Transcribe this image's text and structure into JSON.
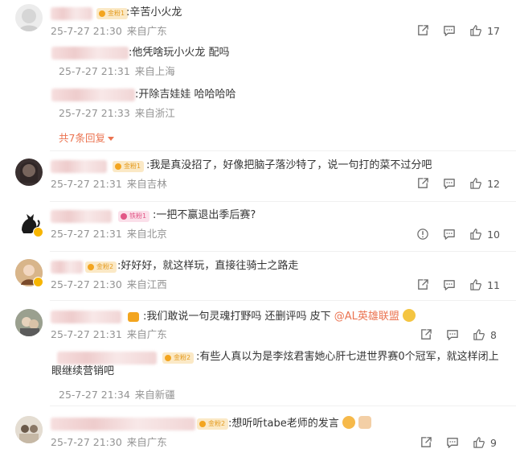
{
  "comments": [
    {
      "badge": "金粉1",
      "text": ":辛苦小火龙",
      "date": "25-7-27 21:30",
      "location": "来自广东",
      "likes": "17",
      "replies": [
        {
          "text": ":他凭啥玩小火龙 配吗",
          "date": "25-7-27 21:31",
          "location": "来自上海"
        },
        {
          "text": ":开除吉娃娃 哈哈哈哈",
          "date": "25-7-27 21:33",
          "location": "来自浙江"
        }
      ],
      "more_replies": "共7条回复"
    },
    {
      "badge": "金粉1",
      "text": ":我是真没招了，好像把脑子落沙特了，说一句打的菜不过分吧",
      "date": "25-7-27 21:31",
      "location": "来自吉林",
      "likes": "12"
    },
    {
      "badge": "铁粉1",
      "text": ":一把不赢退出季后赛?",
      "date": "25-7-27 21:31",
      "location": "来自北京",
      "likes": "10"
    },
    {
      "badge": "金粉2",
      "text": ":好好好，就这样玩，直接往骑士之路走",
      "date": "25-7-27 21:30",
      "location": "来自江西",
      "likes": "11"
    },
    {
      "text": ":我们敢说一句灵魂打野吗 还删评吗 皮下 ",
      "mention": "@AL英雄联盟",
      "date": "25-7-27 21:31",
      "location": "来自广东",
      "likes": "8",
      "replies": [
        {
          "badge": "金粉2",
          "text": ":有些人真以为是李炫君害她心肝七进世界赛0个冠军，就这样闭上眼继续营销吧",
          "date": "25-7-27 21:34",
          "location": "来自新疆"
        }
      ]
    },
    {
      "badge": "金粉2",
      "text": ":想听听tabe老师的发言",
      "date": "25-7-27 21:30",
      "location": "来自广东",
      "likes": "9"
    }
  ],
  "colors": {
    "accent": "#eb7350",
    "meta": "#939393",
    "badge_gold": "#f3a51f",
    "badge_pink": "#e25686"
  }
}
